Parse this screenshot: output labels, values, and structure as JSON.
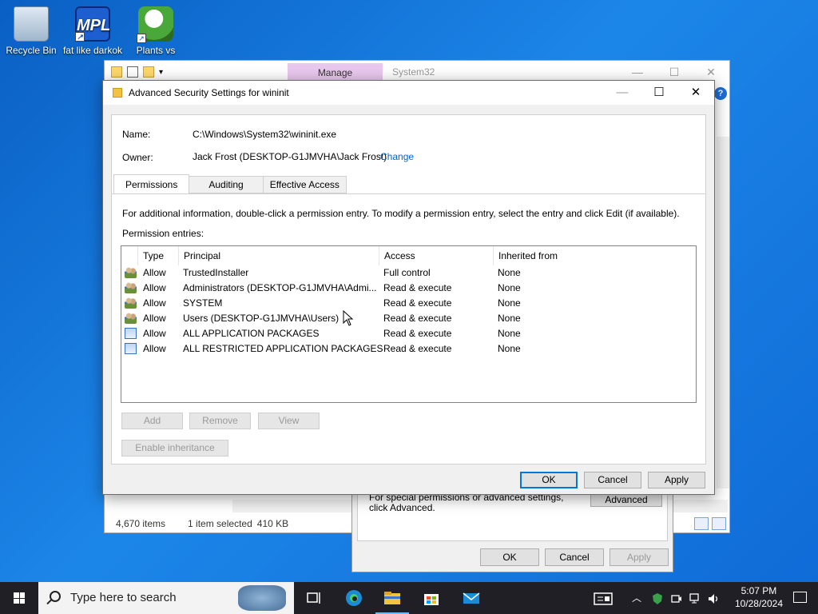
{
  "desktop": {
    "icons": [
      {
        "label": "Recycle Bin",
        "icon": "recycle-bin-icon"
      },
      {
        "label": "fat like darkok",
        "icon": "mpl-shortcut-icon",
        "glyph": "MPL"
      },
      {
        "label": "Plants vs",
        "icon": "plants-vs-zombies-icon"
      }
    ]
  },
  "explorer": {
    "ribbon_tab": "Manage",
    "title": "System32",
    "status": {
      "items": "4,670 items",
      "selected": "1 item selected",
      "size": "410 KB"
    }
  },
  "properties": {
    "note": "For special permissions or advanced settings, click Advanced.",
    "advanced_label": "Advanced",
    "ok_label": "OK",
    "cancel_label": "Cancel",
    "apply_label": "Apply"
  },
  "dialog": {
    "title": "Advanced Security Settings for wininit",
    "name_label": "Name:",
    "name_value": "C:\\Windows\\System32\\wininit.exe",
    "owner_label": "Owner:",
    "owner_value": "Jack Frost (DESKTOP-G1JMVHA\\Jack Frost)",
    "change_label": "Change",
    "tabs": [
      "Permissions",
      "Auditing",
      "Effective Access"
    ],
    "info": "For additional information, double-click a permission entry. To modify a permission entry, select the entry and click Edit (if available).",
    "entries_label": "Permission entries:",
    "columns": [
      "Type",
      "Principal",
      "Access",
      "Inherited from"
    ],
    "rows": [
      {
        "type": "Allow",
        "principal": "TrustedInstaller",
        "access": "Full control",
        "inherited": "None",
        "icon": "users-icon"
      },
      {
        "type": "Allow",
        "principal": "Administrators (DESKTOP-G1JMVHA\\Admi...",
        "access": "Read & execute",
        "inherited": "None",
        "icon": "users-icon"
      },
      {
        "type": "Allow",
        "principal": "SYSTEM",
        "access": "Read & execute",
        "inherited": "None",
        "icon": "users-icon"
      },
      {
        "type": "Allow",
        "principal": "Users (DESKTOP-G1JMVHA\\Users)",
        "access": "Read & execute",
        "inherited": "None",
        "icon": "users-icon"
      },
      {
        "type": "Allow",
        "principal": "ALL APPLICATION PACKAGES",
        "access": "Read & execute",
        "inherited": "None",
        "icon": "package-icon"
      },
      {
        "type": "Allow",
        "principal": "ALL RESTRICTED APPLICATION PACKAGES",
        "access": "Read & execute",
        "inherited": "None",
        "icon": "package-icon"
      }
    ],
    "add_label": "Add",
    "remove_label": "Remove",
    "view_label": "View",
    "inheritance_label": "Enable inheritance",
    "ok_label": "OK",
    "cancel_label": "Cancel",
    "apply_label": "Apply"
  },
  "taskbar": {
    "search_placeholder": "Type here to search",
    "time": "5:07 PM",
    "date": "10/28/2024",
    "accent": "#76b9ed"
  }
}
